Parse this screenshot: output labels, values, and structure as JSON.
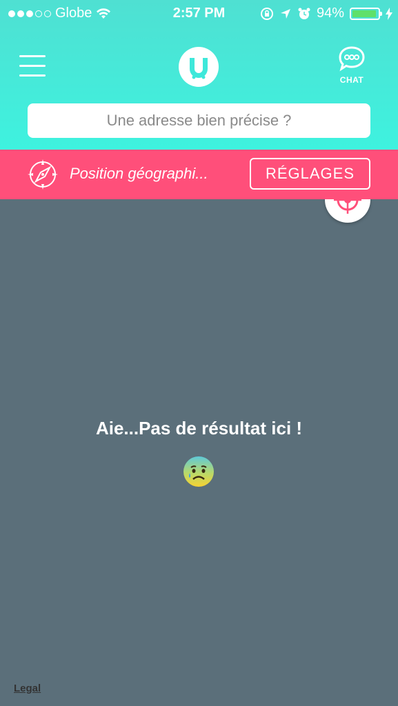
{
  "status_bar": {
    "carrier": "Globe",
    "time": "2:57 PM",
    "battery": "94%",
    "battery_level": 0.94,
    "signal_bars_filled": 3,
    "signal_bars_total": 5
  },
  "header": {
    "chat_label": "CHAT",
    "search_placeholder": "Une adresse bien précise ?"
  },
  "location_bar": {
    "text": "Position géographi...",
    "settings_label": "RÉGLAGES"
  },
  "map": {
    "empty_message": "Aie...Pas de résultat ici !",
    "emoji_icon": "sad-face-sweat-icon"
  },
  "footer": {
    "legal_label": "Legal"
  },
  "colors": {
    "header_top": "#4fe0d2",
    "header_bottom": "#3ef2df",
    "accent_pink": "#ff4f7a",
    "map_background": "#5b6f7a"
  }
}
